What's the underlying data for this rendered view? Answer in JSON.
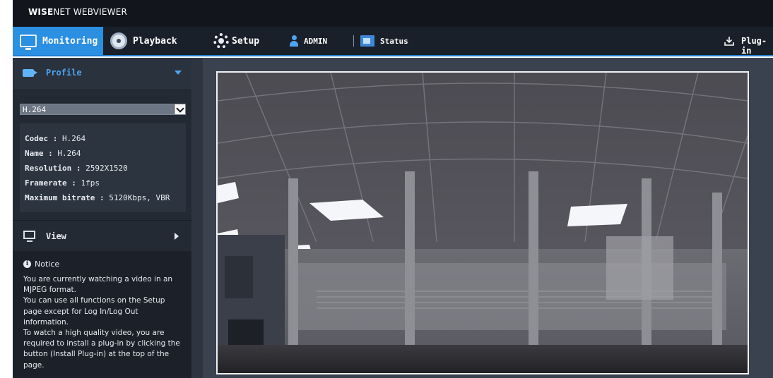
{
  "app": {
    "brand_bold": "WISE",
    "brand_rest": "NET WEBVIEWER"
  },
  "nav": {
    "monitoring": "Monitoring",
    "playback": "Playback",
    "setup": "Setup",
    "user": "ADMIN",
    "status": "Status",
    "plugin": "Plug-in"
  },
  "sidebar": {
    "profile_label": "Profile",
    "profile_select": "H.264",
    "info": {
      "codec_label": "Codec :",
      "codec_value": "H.264",
      "name_label": "Name :",
      "name_value": "H.264",
      "resolution_label": "Resolution :",
      "resolution_value": "2592X1520",
      "framerate_label": "Framerate :",
      "framerate_value": "1fps",
      "bitrate_label": "Maximum bitrate :",
      "bitrate_value": "5120Kbps, VBR"
    },
    "view_label": "View",
    "notice": {
      "title": "Notice",
      "line1": "You are currently watching a video in an",
      "line2": "MJPEG format.",
      "line3": "You can use all functions on the Setup",
      "line4": "page except for Log In/Log Out",
      "line5": "information.",
      "line6": "To watch a high quality video, you are",
      "line7": "required to install a plug-in by clicking the",
      "line8": "button (Install Plug-in) at the top of the",
      "line9": "page."
    }
  },
  "colors": {
    "accent": "#2b8fe2",
    "nav_bg": "#1a2029",
    "sidebar_bg": "#232a34",
    "main_bg": "#3a4250"
  },
  "icons": {
    "monitoring": "monitor-icon",
    "playback": "film-reel-icon",
    "setup": "gear-icon",
    "user": "user-icon",
    "status": "status-icon",
    "plugin": "download-icon",
    "profile": "camera-icon",
    "view": "monitor-icon",
    "notice": "info-icon"
  }
}
